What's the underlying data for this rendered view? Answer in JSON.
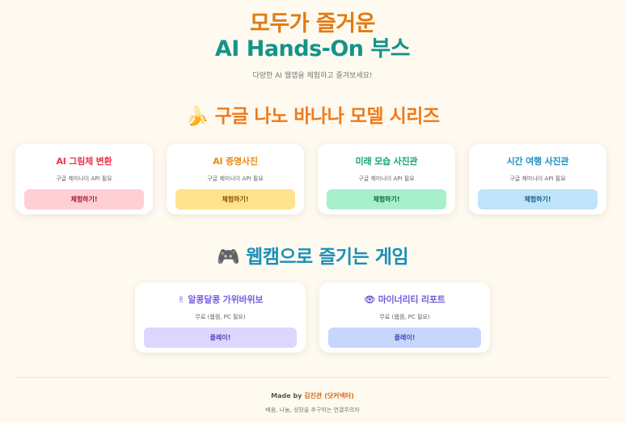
{
  "hero": {
    "title_line1": "모두가 즐거운",
    "title_line2": "AI Hands-On 부스",
    "subtitle": "다양한 AI 웹앱을 체험하고 즐겨보세요!"
  },
  "section1": {
    "emoji": "🍌",
    "title": "구글 나노 바나나 모델 시리즈",
    "cards": [
      {
        "title": "AI 그림체 변환",
        "desc": "구글 제미나이 API 필요",
        "button": "체험하기!",
        "title_color": "#e8364f",
        "button_bg": "#ffcfd6",
        "button_color": "#a3182d"
      },
      {
        "title": "AI 증명사진",
        "desc": "구글 제미나이 API 필요",
        "button": "체험하기!",
        "title_color": "#e88a14",
        "button_bg": "#ffe28c",
        "button_color": "#8a5300"
      },
      {
        "title": "미래 모습 사진관",
        "desc": "구글 제미나이 API 필요",
        "button": "체험하기!",
        "title_color": "#14a66e",
        "button_bg": "#a8f0cc",
        "button_color": "#0b6b41"
      },
      {
        "title": "시간 여행 사진관",
        "desc": "구글 제미나이 API 필요",
        "button": "체험하기!",
        "title_color": "#1b8ec4",
        "button_bg": "#bfe4fb",
        "button_color": "#145f8a"
      }
    ]
  },
  "section2": {
    "emoji": "🎮",
    "title": "웹캠으로 즐기는 게임",
    "cards": [
      {
        "icon": "✌",
        "title": "알콩달콩 가위바위보",
        "desc": "무료 (웹캠, PC 필요)",
        "button": "플레이!",
        "title_color": "#7b5ce0",
        "button_bg": "#ddd6fe",
        "button_color": "#5b3db3"
      },
      {
        "icon": "👁",
        "title": "마이너리티 리포트",
        "desc": "무료 (웹캠, PC 필요)",
        "button": "플레이!",
        "title_color": "#6a5fd6",
        "button_bg": "#c7d6fd",
        "button_color": "#3b4fb3"
      }
    ]
  },
  "footer": {
    "made_by_prefix": "Made by",
    "author": "김진관 (닷커넥터)",
    "tagline": "배움, 나눔, 성장을 추구하는 연결주의자"
  }
}
